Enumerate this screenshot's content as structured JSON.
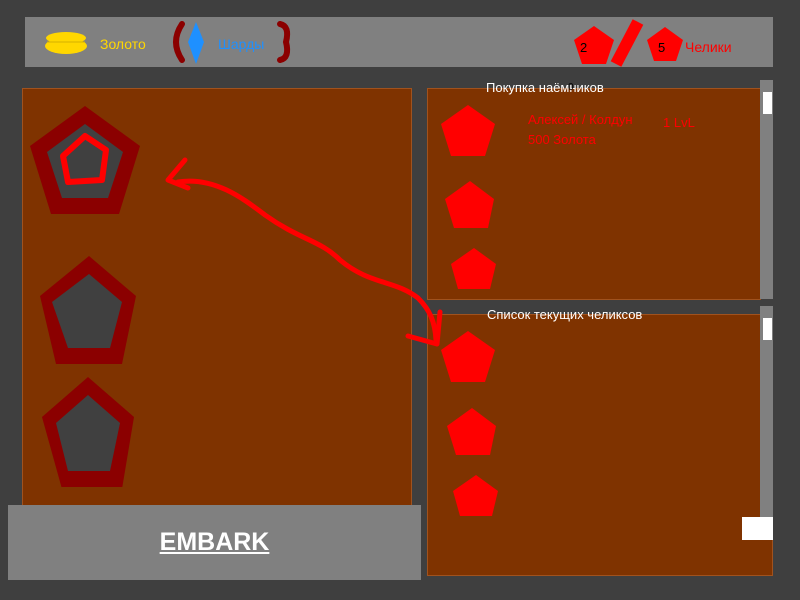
{
  "topbar": {
    "gold_label": "Золото",
    "shards_label": "Шарды",
    "merc_count_a": "2",
    "merc_count_b": "5",
    "merc_label": "Челики"
  },
  "shop": {
    "title": "Покупка наёмников",
    "title_mark": "0",
    "offer": {
      "name": "Алексей / Колдун",
      "price": "500 Золота",
      "level": "1 LvL"
    }
  },
  "roster": {
    "title": "Список текущих челиксов"
  },
  "embark": {
    "label": "EMBARK"
  },
  "colors": {
    "gold": "#ffd700",
    "shards": "#1e90ff",
    "accent": "#ff0000",
    "panel": "#7f3300",
    "frame": "#8b0000"
  }
}
